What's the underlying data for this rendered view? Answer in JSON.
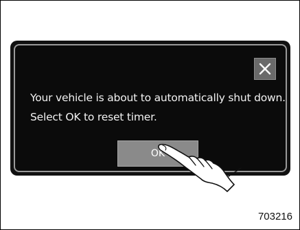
{
  "dialog": {
    "message_line1": "Your vehicle is about to automatically shut down.",
    "message_line2": "Select OK to reset timer.",
    "ok_label": "OK",
    "close_icon": "close-icon"
  },
  "figure": {
    "number": "703216"
  },
  "colors": {
    "dialog_background": "#0b0b0b",
    "dialog_border": "#9a9a9a",
    "button_background": "#8a8a8a",
    "close_button_background": "#6a6a6a",
    "text": "#f2f2f2"
  }
}
